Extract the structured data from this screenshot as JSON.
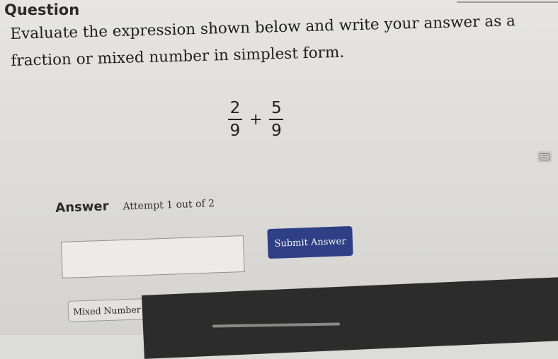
{
  "header": {
    "title": "Question"
  },
  "question": {
    "prompt": "Evaluate the expression shown below and write your answer as a fraction or mixed number in simplest form.",
    "expression": {
      "fraction1": {
        "numerator": "2",
        "denominator": "9"
      },
      "operator": "+",
      "fraction2": {
        "numerator": "5",
        "denominator": "9"
      }
    }
  },
  "answer": {
    "label": "Answer",
    "attempt_text": "Attempt 1 out of 2",
    "input_value": "",
    "submit_label": "Submit Answer",
    "mixed_number_label": "Mixed Number"
  },
  "icons": {
    "calculator": "calculator-icon"
  },
  "colors": {
    "submit_button": "#2e3f86",
    "background": "#dcdcd8"
  }
}
